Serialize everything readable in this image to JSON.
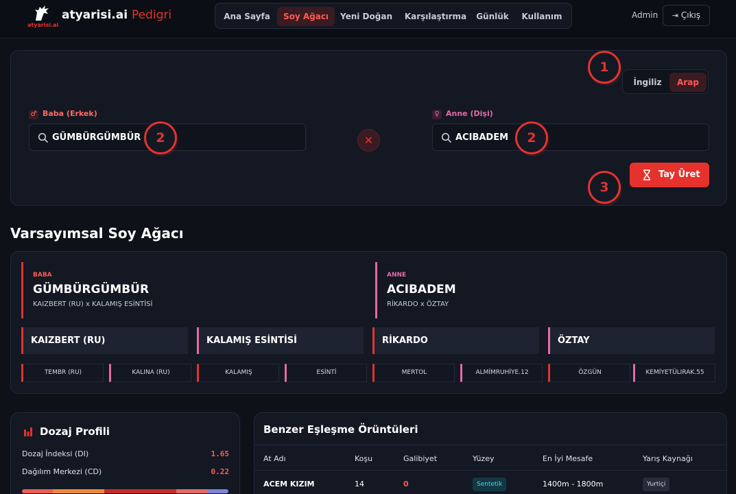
{
  "header": {
    "logo_small": "atyarisi.ai",
    "brand": "atyarisi.ai",
    "brand_suffix": "Pedigri",
    "nav": [
      "Ana Sayfa",
      "Soy Ağacı",
      "Yeni Doğan",
      "Karşılaştırma",
      "Günlük",
      "Kullanım"
    ],
    "active_nav": "Soy Ağacı",
    "user": "Admin",
    "logout": "Çıkış"
  },
  "search": {
    "badges": [
      "1",
      "2",
      "2",
      "3"
    ],
    "breed_options": [
      "İngiliz",
      "Arap"
    ],
    "breed_selected": "Arap",
    "sire_label": "Baba (Erkek)",
    "sire_symbol": "♂",
    "sire_value": "GÜMBÜRGÜMBÜR",
    "dam_label": "Anne (Dişi)",
    "dam_symbol": "♀",
    "dam_value": "ACIBADEM",
    "generate_label": "Tay Üret"
  },
  "pedigree": {
    "title": "Varsayımsal Soy Ağacı",
    "sire": {
      "tag": "BABA",
      "name": "GÜMBÜRGÜMBÜR",
      "sub": "KAIZBERT (RU) x KALAMIŞ ESİNTİSİ"
    },
    "dam": {
      "tag": "ANNE",
      "name": "ACIBADEM",
      "sub": "RİKARDO x ÖZTAY"
    },
    "grandparents": [
      "KAIZBERT (RU)",
      "KALAMIŞ ESİNTİSİ",
      "RİKARDO",
      "ÖZTAY"
    ],
    "great_grandparents": [
      "TEMBR (RU)",
      "KALINA (RU)",
      "KALAMIŞ",
      "ESİNTİ",
      "MERTOL",
      "ALMİMRUHİYE.12",
      "ÖZGÜN",
      "KEMİYETÜLIRAK.55"
    ]
  },
  "dosage": {
    "title": "Dozaj Profili",
    "rows": [
      {
        "label": "Dozaj İndeksi (DI)",
        "value": "1.65"
      },
      {
        "label": "Dağılım Merkezi (CD)",
        "value": "0.22"
      }
    ]
  },
  "similar": {
    "title": "Benzer Eşleşme Örüntüleri",
    "columns": [
      "At Adı",
      "Koşu",
      "Galibiyet",
      "Yüzey",
      "En İyi Mesafe",
      "Yarış Kaynağı"
    ],
    "rows": [
      {
        "name": "ACEM KIZIM",
        "runs": "14",
        "wins": "0",
        "surface": "Sentetik",
        "distance": "1400m - 1800m",
        "source": "Yurtiçi"
      }
    ]
  },
  "colors": {
    "accent": "#e5322d",
    "male": "#e5322d",
    "female": "#e86aa5",
    "synthetic": "#4fd2e6"
  }
}
